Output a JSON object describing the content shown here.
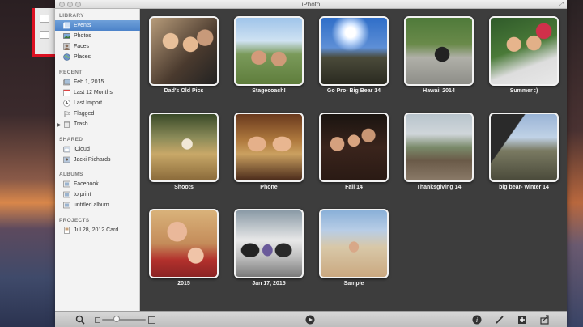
{
  "window": {
    "title": "iPhoto"
  },
  "sidebar": {
    "sections": [
      {
        "title": "LIBRARY",
        "items": [
          {
            "label": "Events",
            "icon": "events-icon",
            "selected": true
          },
          {
            "label": "Photos",
            "icon": "photos-icon"
          },
          {
            "label": "Faces",
            "icon": "faces-icon"
          },
          {
            "label": "Places",
            "icon": "places-icon"
          }
        ]
      },
      {
        "title": "RECENT",
        "items": [
          {
            "label": "Feb 1, 2015",
            "icon": "event-icon"
          },
          {
            "label": "Last 12 Months",
            "icon": "calendar-icon"
          },
          {
            "label": "Last Import",
            "icon": "import-icon"
          },
          {
            "label": "Flagged",
            "icon": "flag-icon"
          },
          {
            "label": "Trash",
            "icon": "trash-icon"
          }
        ]
      },
      {
        "title": "SHARED",
        "items": [
          {
            "label": "iCloud",
            "icon": "icloud-icon"
          },
          {
            "label": "Jacki Richards",
            "icon": "shared-stream-icon"
          }
        ]
      },
      {
        "title": "ALBUMS",
        "items": [
          {
            "label": "Facebook",
            "icon": "album-icon"
          },
          {
            "label": "to print",
            "icon": "album-icon"
          },
          {
            "label": "untitled album",
            "icon": "album-icon"
          }
        ]
      },
      {
        "title": "PROJECTS",
        "items": [
          {
            "label": "Jul 28, 2012 Card",
            "icon": "card-icon"
          }
        ]
      }
    ]
  },
  "events": [
    {
      "caption": "Dad's Old Pics"
    },
    {
      "caption": "Stagecoach!"
    },
    {
      "caption": "Go Pro- Big Bear 14"
    },
    {
      "caption": "Hawaii 2014"
    },
    {
      "caption": "Summer :)"
    },
    {
      "caption": "Shoots"
    },
    {
      "caption": "Phone"
    },
    {
      "caption": "Fall 14"
    },
    {
      "caption": "Thanksgiving 14"
    },
    {
      "caption": "big bear- winter 14"
    },
    {
      "caption": "2015"
    },
    {
      "caption": "Jan 17, 2015"
    },
    {
      "caption": "Sample"
    }
  ],
  "colors": {
    "selection": "#4c83c9",
    "content_bg": "#3d3d3d",
    "sidebar_bg": "#f3f3f3"
  }
}
